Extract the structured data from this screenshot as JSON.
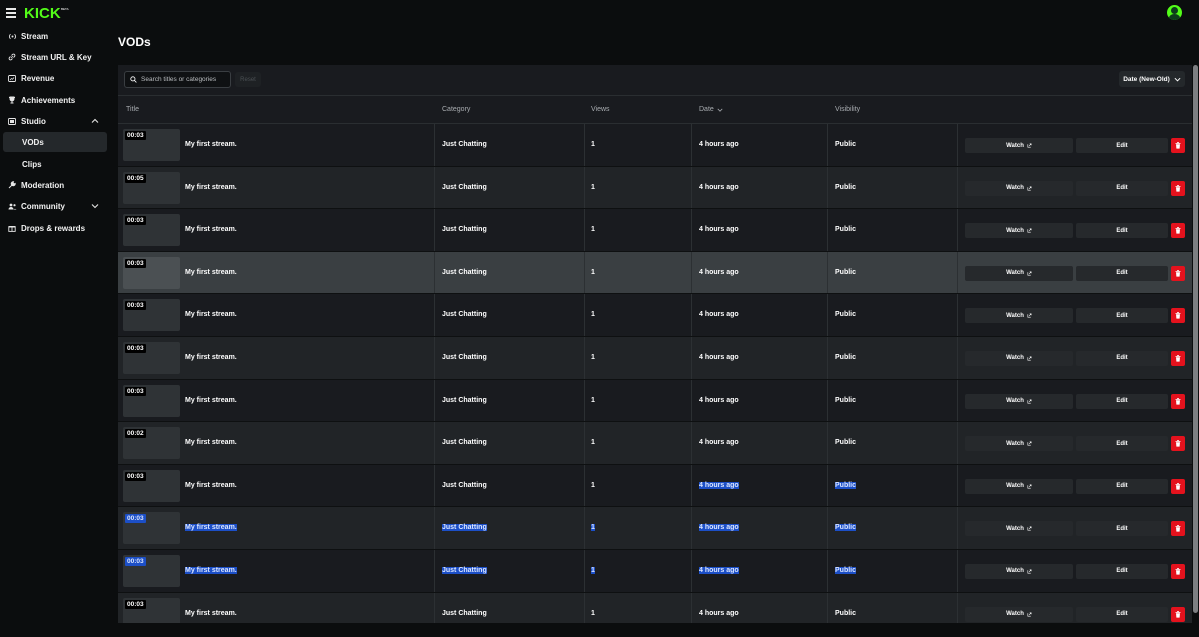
{
  "brand": {
    "logo_text": "KICK",
    "badge": "BETA",
    "accent": "#53fc18"
  },
  "sidebar": {
    "items": [
      {
        "label": "Stream",
        "icon": "broadcast-icon"
      },
      {
        "label": "Stream URL & Key",
        "icon": "link-icon"
      },
      {
        "label": "Revenue",
        "icon": "revenue-icon"
      },
      {
        "label": "Achievements",
        "icon": "trophy-icon"
      },
      {
        "label": "Studio",
        "icon": "studio-icon"
      },
      {
        "label": "VODs",
        "icon": ""
      },
      {
        "label": "Clips",
        "icon": ""
      },
      {
        "label": "Moderation",
        "icon": "wrench-icon"
      },
      {
        "label": "Community",
        "icon": "community-icon"
      },
      {
        "label": "Drops & rewards",
        "icon": "gift-icon"
      }
    ]
  },
  "page": {
    "title": "VODs"
  },
  "toolbar": {
    "search_placeholder": "Search titles or categories",
    "reset_label": "Reset",
    "sort_label": "Date (New-Old)"
  },
  "table": {
    "headers": {
      "title": "Title",
      "category": "Category",
      "views": "Views",
      "date": "Date",
      "visibility": "Visibility"
    },
    "watch_label": "Watch",
    "edit_label": "Edit",
    "delete_color": "#e4121d",
    "rows": [
      {
        "duration": "00:03",
        "title": "My first stream.",
        "category": "Just Chatting",
        "views": "1",
        "date": "4 hours ago",
        "visibility": "Public"
      },
      {
        "duration": "00:05",
        "title": "My first stream.",
        "category": "Just Chatting",
        "views": "1",
        "date": "4 hours ago",
        "visibility": "Public"
      },
      {
        "duration": "00:03",
        "title": "My first stream.",
        "category": "Just Chatting",
        "views": "1",
        "date": "4 hours ago",
        "visibility": "Public"
      },
      {
        "duration": "00:03",
        "title": "My first stream.",
        "category": "Just Chatting",
        "views": "1",
        "date": "4 hours ago",
        "visibility": "Public"
      },
      {
        "duration": "00:03",
        "title": "My first stream.",
        "category": "Just Chatting",
        "views": "1",
        "date": "4 hours ago",
        "visibility": "Public"
      },
      {
        "duration": "00:03",
        "title": "My first stream.",
        "category": "Just Chatting",
        "views": "1",
        "date": "4 hours ago",
        "visibility": "Public"
      },
      {
        "duration": "00:03",
        "title": "My first stream.",
        "category": "Just Chatting",
        "views": "1",
        "date": "4 hours ago",
        "visibility": "Public"
      },
      {
        "duration": "00:02",
        "title": "My first stream.",
        "category": "Just Chatting",
        "views": "1",
        "date": "4 hours ago",
        "visibility": "Public"
      },
      {
        "duration": "00:03",
        "title": "My first stream.",
        "category": "Just Chatting",
        "views": "1",
        "date": "4 hours ago",
        "visibility": "Public"
      },
      {
        "duration": "00:03",
        "title": "My first stream.",
        "category": "Just Chatting",
        "views": "1",
        "date": "4 hours ago",
        "visibility": "Public"
      },
      {
        "duration": "00:03",
        "title": "My first stream.",
        "category": "Just Chatting",
        "views": "1",
        "date": "4 hours ago",
        "visibility": "Public"
      },
      {
        "duration": "00:03",
        "title": "My first stream.",
        "category": "Just Chatting",
        "views": "1",
        "date": "4 hours ago",
        "visibility": "Public"
      }
    ]
  }
}
